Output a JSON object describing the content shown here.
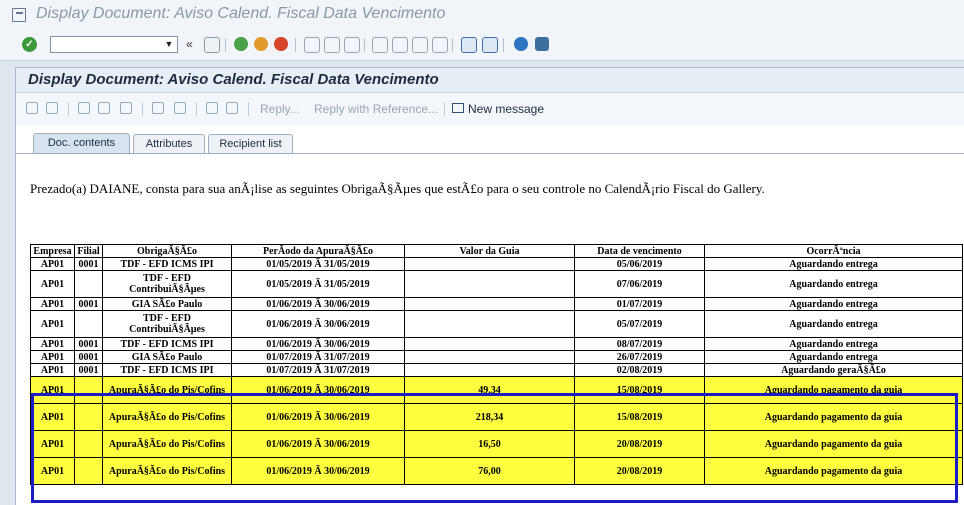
{
  "window": {
    "title": "Display Document: Aviso Calend. Fiscal Data Vencimento"
  },
  "systoolbar": {
    "command_value": "",
    "back_label": "«"
  },
  "document": {
    "title": "Display Document: Aviso Calend. Fiscal Data Vencimento"
  },
  "apptoolbar": {
    "reply_label": "Reply...",
    "reply_ref_label": "Reply with Reference...",
    "new_message_label": "New message"
  },
  "tabs": [
    {
      "label": "Doc. contents"
    },
    {
      "label": "Attributes"
    },
    {
      "label": "Recipient list"
    }
  ],
  "intro": "Prezado(a) DAIANE, consta para sua anÃ¡lise as seguintes ObrigaÃ§Ãµes que estÃ£o para o seu controle no CalendÃ¡rio Fiscal do Gallery.",
  "table": {
    "headers": [
      "Empresa",
      "Filial",
      "ObrigaÃ§Ã£o",
      "PerÃodo da ApuraÃ§Ã£o",
      "Valor da Guia",
      "Data de vencimento",
      "OcorrÃªncia"
    ],
    "rows": [
      [
        "AP01",
        "0001",
        "TDF - EFD ICMS IPI",
        "01/05/2019 Ã 31/05/2019",
        "",
        "05/06/2019",
        "Aguardando entrega"
      ],
      [
        "AP01",
        "",
        "TDF - EFD ContribuiÃ§Ãµes",
        "01/05/2019 Ã 31/05/2019",
        "",
        "07/06/2019",
        "Aguardando entrega"
      ],
      [
        "AP01",
        "0001",
        "GIA SÃ£o Paulo",
        "01/06/2019 Ã 30/06/2019",
        "",
        "01/07/2019",
        "Aguardando entrega"
      ],
      [
        "AP01",
        "",
        "TDF - EFD ContribuiÃ§Ãµes",
        "01/06/2019 Ã 30/06/2019",
        "",
        "05/07/2019",
        "Aguardando entrega"
      ],
      [
        "AP01",
        "0001",
        "TDF - EFD ICMS IPI",
        "01/06/2019 Ã 30/06/2019",
        "",
        "08/07/2019",
        "Aguardando entrega"
      ],
      [
        "AP01",
        "0001",
        "GIA SÃ£o Paulo",
        "01/07/2019 Ã 31/07/2019",
        "",
        "26/07/2019",
        "Aguardando entrega"
      ],
      [
        "AP01",
        "0001",
        "TDF - EFD ICMS IPI",
        "01/07/2019 Ã 31/07/2019",
        "",
        "02/08/2019",
        "Aguardando geraÃ§Ã£o"
      ],
      [
        "AP01",
        "",
        "ApuraÃ§Ã£o do Pis/Cofins",
        "01/06/2019 Ã 30/06/2019",
        "49,34",
        "15/08/2019",
        "Aguardando pagamento da guia"
      ],
      [
        "AP01",
        "",
        "ApuraÃ§Ã£o do Pis/Cofins",
        "01/06/2019 Ã 30/06/2019",
        "218,34",
        "15/08/2019",
        "Aguardando pagamento da guia"
      ],
      [
        "AP01",
        "",
        "ApuraÃ§Ã£o do Pis/Cofins",
        "01/06/2019 Ã 30/06/2019",
        "16,50",
        "20/08/2019",
        "Aguardando pagamento da guia"
      ],
      [
        "AP01",
        "",
        "ApuraÃ§Ã£o do Pis/Cofins",
        "01/06/2019 Ã 30/06/2019",
        "76,00",
        "20/08/2019",
        "Aguardando pagamento da guia"
      ]
    ]
  },
  "colors": {
    "highlight_fill": "#ffff40",
    "highlight_border": "#1c1cc4"
  }
}
